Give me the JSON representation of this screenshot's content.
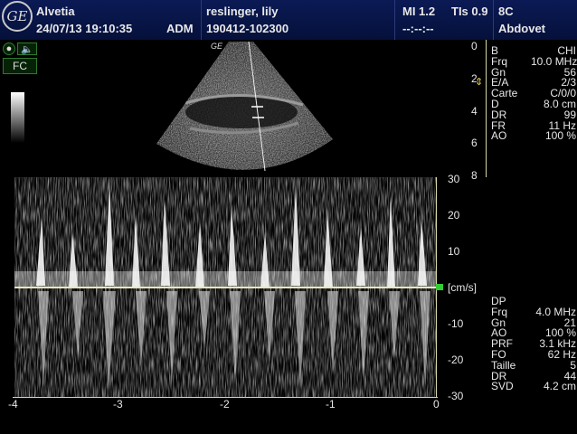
{
  "header": {
    "logo_text": "GE",
    "facility": "Alvetia",
    "date_time": "24/07/13 19:10:35",
    "operator": "ADM",
    "patient_name": "reslinger, lily",
    "patient_id": "190412-102300",
    "mi": "MI 1.2",
    "tis": "TIs 0.9",
    "probe": "8C",
    "timer": "--:--:--",
    "preset": "Abdovet"
  },
  "left_controls": {
    "fc_label": "FC"
  },
  "bmode": {
    "label": "GE",
    "depth_ticks": [
      "0",
      "2",
      "4",
      "6",
      "8"
    ],
    "params": [
      {
        "k": "B",
        "v": "CHI"
      },
      {
        "k": "Frq",
        "v": "10.0 MHz"
      },
      {
        "k": "Gn",
        "v": "56"
      },
      {
        "k": "E/A",
        "v": "2/3"
      },
      {
        "k": "Carte",
        "v": "C/0/0"
      },
      {
        "k": "D",
        "v": "8.0 cm"
      },
      {
        "k": "DR",
        "v": "99"
      },
      {
        "k": "FR",
        "v": "11 Hz"
      },
      {
        "k": "AO",
        "v": "100 %"
      }
    ]
  },
  "doppler": {
    "velocity_ticks": [
      "30",
      "20",
      "10",
      "[cm/s]",
      "-10",
      "-20",
      "-30"
    ],
    "time_ticks": [
      "-4",
      "-3",
      "-2",
      "-1",
      "0"
    ],
    "params": [
      {
        "k": "DP",
        "v": ""
      },
      {
        "k": "Frq",
        "v": "4.0 MHz"
      },
      {
        "k": "Gn",
        "v": "21"
      },
      {
        "k": "AO",
        "v": "100 %"
      },
      {
        "k": "PRF",
        "v": "3.1 kHz"
      },
      {
        "k": "FO",
        "v": "62 Hz"
      },
      {
        "k": "Taille",
        "v": "5"
      },
      {
        "k": "DR",
        "v": "44"
      },
      {
        "k": "SVD",
        "v": "4.2 cm"
      }
    ]
  },
  "colors": {
    "header_bg": "#0b1a55",
    "baseline": "#e8e8b8",
    "marker": "#33cc33"
  }
}
